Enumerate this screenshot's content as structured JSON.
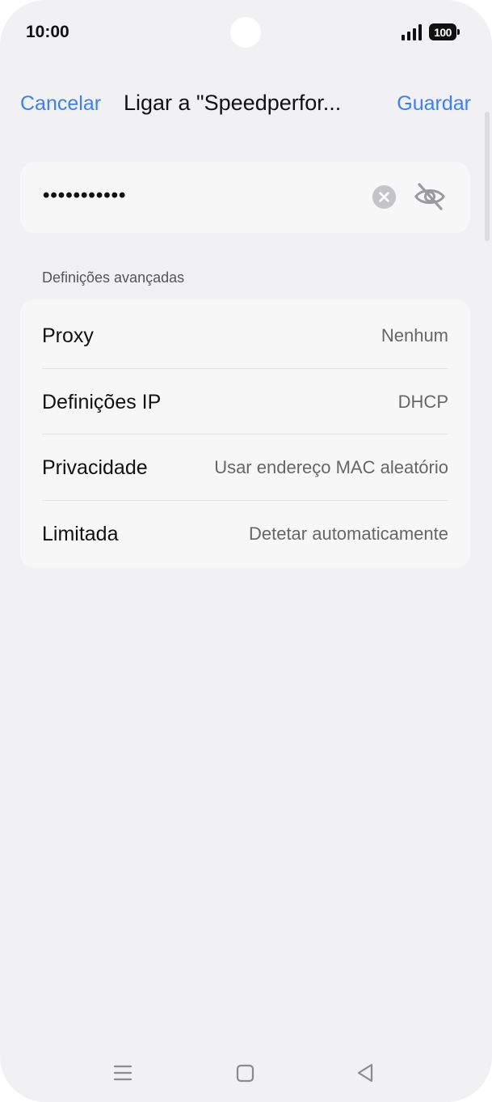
{
  "status_bar": {
    "time": "10:00",
    "battery": "100"
  },
  "header": {
    "cancel_label": "Cancelar",
    "title": "Ligar a \"Speedperfor...",
    "save_label": "Guardar"
  },
  "password": {
    "value": "•••••••••••"
  },
  "advanced": {
    "section_label": "Definições avançadas",
    "rows": [
      {
        "label": "Proxy",
        "value": "Nenhum"
      },
      {
        "label": "Definições IP",
        "value": "DHCP"
      },
      {
        "label": "Privacidade",
        "value": "Usar endereço MAC aleatório"
      },
      {
        "label": "Limitada",
        "value": "Detetar automaticamente"
      }
    ]
  },
  "colors": {
    "accent": "#3d7ff3",
    "background": "#f1f1f3",
    "card": "#f7f7f8"
  }
}
